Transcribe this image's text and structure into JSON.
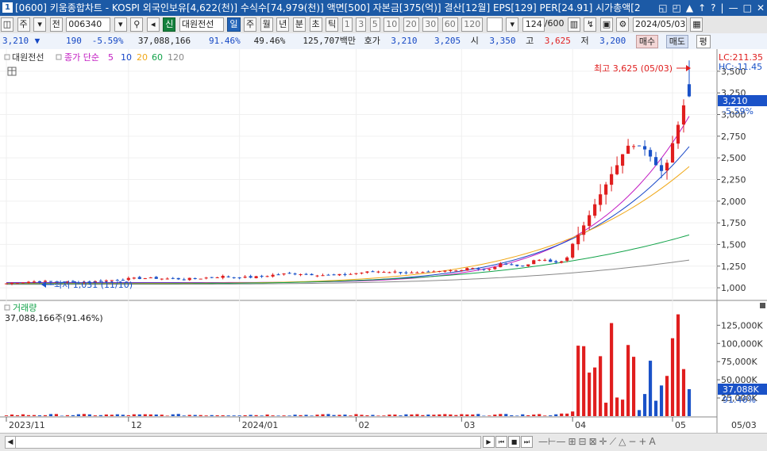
{
  "window": {
    "number": "1",
    "title": "[0600] 키움종합차트 - KOSPI 외국인보유[4,622(천)] 수식수[74,979(천)] 액면[500] 자본금[375(억)] 결산[12월] EPS[129] PER[24.91] 시가총액[2",
    "controls": [
      "◱",
      "◰",
      "▲",
      "↑",
      "?",
      "|",
      "—",
      "□",
      "✕"
    ]
  },
  "toolbar": {
    "stock_code": "006340",
    "stock_name": "대원전선",
    "market_badge": "신",
    "code_prefix_buttons": [
      "주",
      "전"
    ],
    "period_buttons": [
      "일",
      "주",
      "월",
      "년",
      "분",
      "초",
      "틱"
    ],
    "active_period": "일",
    "interval_buttons": [
      "1",
      "3",
      "5",
      "10",
      "20",
      "30",
      "60",
      "120"
    ],
    "count": "124",
    "count_total": "/600",
    "date": "2024/05/03"
  },
  "quote": {
    "price": "3,210",
    "change_arrow": "▼",
    "change": "190",
    "change_rate": "-5.59%",
    "volume": "37,088,166",
    "vol_ratio1": "91.46%",
    "vol_ratio2": "49.46%",
    "amount": "125,707백만",
    "bid_label": "호가",
    "bid1": "3,210",
    "bid2": "3,205",
    "open_label": "시",
    "open": "3,350",
    "high_label": "고",
    "high": "3,625",
    "low_label": "저",
    "low": "3,200",
    "buy_label": "매수",
    "sell_label": "매도",
    "flat_label": "평"
  },
  "legend": {
    "name": "대원전선",
    "ma_label": "종가 단순",
    "ma": [
      {
        "period": "5",
        "color": "#c21bc2"
      },
      {
        "period": "10",
        "color": "#1646c8"
      },
      {
        "period": "20",
        "color": "#f0a818"
      },
      {
        "period": "60",
        "color": "#13a34a"
      },
      {
        "period": "120",
        "color": "#888888"
      }
    ],
    "volume_title": "거래량",
    "volume_value": "37,088,166주(91.46%)"
  },
  "annotations": {
    "max_text": "최고 3,625 (05/03)",
    "min_text": "최저 1,031 (11/10)",
    "lc_text": "LC:211.35",
    "hc_text": "HC:-11.45",
    "price_tag": "3,210",
    "rate_tag": "-5.59%",
    "vol_tag": "37,088K",
    "vol_rate_tag": "91.46%"
  },
  "colors": {
    "up": "#e01e1e",
    "down": "#1a52c8",
    "title_bar": "#1c5aa6",
    "accent_blue": "#1447c4"
  },
  "chart_data": [
    {
      "type": "candlestick",
      "title": "대원전선 일봉",
      "ylim": [
        900,
        3700
      ],
      "yticks": [
        "1,000",
        "1,250",
        "1,500",
        "1,750",
        "2,000",
        "2,250",
        "2,500",
        "2,750",
        "3,000",
        "3,250",
        "3,500"
      ],
      "ytick_values": [
        1000,
        1250,
        1500,
        1750,
        2000,
        2250,
        2500,
        2750,
        3000,
        3250,
        3500
      ],
      "xticks": [
        "2023/11",
        "12",
        "2024/01",
        "02",
        "03",
        "04",
        "05"
      ],
      "xtick_index": [
        0,
        22,
        42,
        63,
        82,
        102,
        120
      ],
      "date_label": "05/03",
      "ma_final": {
        "5": 2980,
        "10": 2630,
        "20": 2400,
        "60": 1610,
        "120": 1320
      },
      "ma_start": {
        "5": 1060,
        "10": 1055,
        "20": 1050,
        "60": 1045,
        "120": 1040
      },
      "key_candles": [
        {
          "date": "11/10",
          "low": 1031
        },
        {
          "date": "05/03",
          "open": 3350,
          "high": 3625,
          "low": 3200,
          "close": 3210
        }
      ]
    },
    {
      "type": "bar",
      "title": "거래량",
      "ylim": [
        0,
        145000
      ],
      "yticks": [
        "25,000K",
        "50,000K",
        "75,000K",
        "100,000K",
        "125,000K"
      ],
      "ytick_values": [
        25000,
        50000,
        75000,
        100000,
        125000
      ],
      "unit": "K"
    }
  ]
}
